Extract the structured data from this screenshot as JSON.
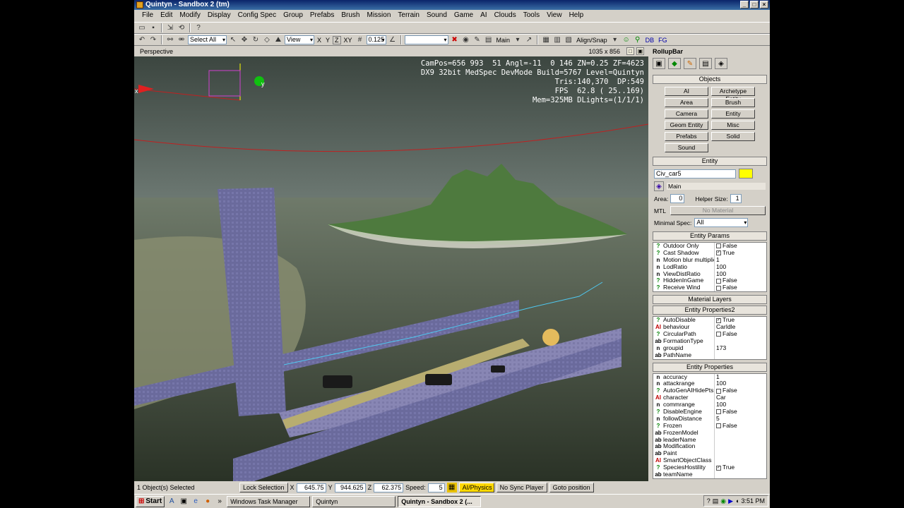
{
  "window": {
    "title": "Quintyn - Sandbox 2 (tm)"
  },
  "menu": [
    "File",
    "Edit",
    "Modify",
    "Display",
    "Config Spec",
    "Group",
    "Prefabs",
    "Brush",
    "Mission",
    "Terrain",
    "Sound",
    "Game",
    "AI",
    "Clouds",
    "Tools",
    "View",
    "Help"
  ],
  "toolbar": {
    "select_filter": "Select All",
    "ref_coord": "View",
    "axis_x": "X",
    "axis_y": "Y",
    "axis_z": "Z",
    "axis_xy": "XY",
    "grid_size": "0.125",
    "layer": "Main",
    "align_snap": "Align/Snap",
    "db": "DB",
    "fg": "FG"
  },
  "viewport": {
    "name": "Perspective",
    "size": "1035 x 856",
    "hud": [
      "CamPos=656 993  51 Angl=-11  0 146 ZN=0.25 ZF=4623",
      "DX9 32bit MedSpec DevMode Build=5767 Level=Quintyn",
      "Tris:140,370  DP:549",
      "FPS  62.8 ( 25..169)",
      "Mem=325MB DLights=(1/1/1)"
    ],
    "gizmo_y": "y",
    "gizmo_x": "x"
  },
  "status": {
    "selected": "1 Object(s) Selected",
    "lock_selection": "Lock Selection",
    "x_label": "X",
    "x": "645.75",
    "y_label": "Y",
    "y": "944.625",
    "z_label": "Z",
    "z": "62.375",
    "speed_label": "Speed:",
    "speed": "5",
    "ai_physics": "AI/Physics",
    "no_sync": "No Sync Player",
    "goto": "Goto position"
  },
  "rollup": {
    "title": "RollupBar",
    "objects_head": "Objects",
    "objects": [
      "AI",
      "Archetype Entity",
      "Area",
      "Brush",
      "Camera",
      "Entity",
      "Geom Entity",
      "Misc",
      "Prefabs",
      "Solid",
      "Sound"
    ],
    "entity_head": "Entity",
    "entity_name": "Civ_car5",
    "entity_color": "#ffff00",
    "layer": "Main",
    "area_label": "Area:",
    "area": "0",
    "helper_label": "Helper Size:",
    "helper": "1",
    "mtl_label": "MTL",
    "mtl": "No Material",
    "minspec_label": "Minimal Spec:",
    "minspec": "All",
    "params_head": "Entity Params",
    "params": [
      {
        "i": "?",
        "n": "Outdoor Only",
        "c": false,
        "v": "False"
      },
      {
        "i": "?",
        "n": "Cast Shadow",
        "c": true,
        "v": "True"
      },
      {
        "i": "n",
        "n": "Motion blur multiplier",
        "v": "1"
      },
      {
        "i": "n",
        "n": "LodRatio",
        "v": "100"
      },
      {
        "i": "n",
        "n": "ViewDistRatio",
        "v": "100"
      },
      {
        "i": "?",
        "n": "HiddenInGame",
        "c": false,
        "v": "False"
      },
      {
        "i": "?",
        "n": "Receive Wind",
        "c": false,
        "v": "False"
      }
    ],
    "material_layers": "Material Layers",
    "props2_head": "Entity Properties2",
    "props2": [
      {
        "i": "?",
        "n": "AutoDisable",
        "c": true,
        "v": "True"
      },
      {
        "i": "AI",
        "n": "behaviour",
        "v": "CarIdle"
      },
      {
        "i": "?",
        "n": "CircularPath",
        "c": false,
        "v": "False"
      },
      {
        "i": "ab",
        "n": "FormationType",
        "v": ""
      },
      {
        "i": "n",
        "n": "groupid",
        "v": "173"
      },
      {
        "i": "ab",
        "n": "PathName",
        "v": ""
      }
    ],
    "props_head": "Entity Properties",
    "props": [
      {
        "i": "n",
        "n": "accuracy",
        "v": "1"
      },
      {
        "i": "n",
        "n": "attackrange",
        "v": "100"
      },
      {
        "i": "?",
        "n": "AutoGenAIHidePts",
        "c": false,
        "v": "False"
      },
      {
        "i": "AI",
        "n": "character",
        "v": "Car"
      },
      {
        "i": "n",
        "n": "commrange",
        "v": "100"
      },
      {
        "i": "?",
        "n": "DisableEngine",
        "c": false,
        "v": "False"
      },
      {
        "i": "n",
        "n": "followDistance",
        "v": "5"
      },
      {
        "i": "?",
        "n": "Frozen",
        "c": false,
        "v": "False"
      },
      {
        "i": "ab",
        "n": "FrozenModel",
        "v": ""
      },
      {
        "i": "ab",
        "n": "leaderName",
        "v": ""
      },
      {
        "i": "ab",
        "n": "Modification",
        "v": ""
      },
      {
        "i": "ab",
        "n": "Paint",
        "v": ""
      },
      {
        "i": "AI",
        "n": "SmartObjectClass",
        "v": ""
      },
      {
        "i": "?",
        "n": "SpeciesHostility",
        "c": true,
        "v": "True"
      },
      {
        "i": "ab",
        "n": "teamName",
        "v": ""
      }
    ]
  },
  "taskbar": {
    "start": "Start",
    "tasks": [
      "Windows Task Manager",
      "Quintyn",
      "Quintyn - Sandbox 2 (..."
    ],
    "clock": "3:51 PM"
  }
}
